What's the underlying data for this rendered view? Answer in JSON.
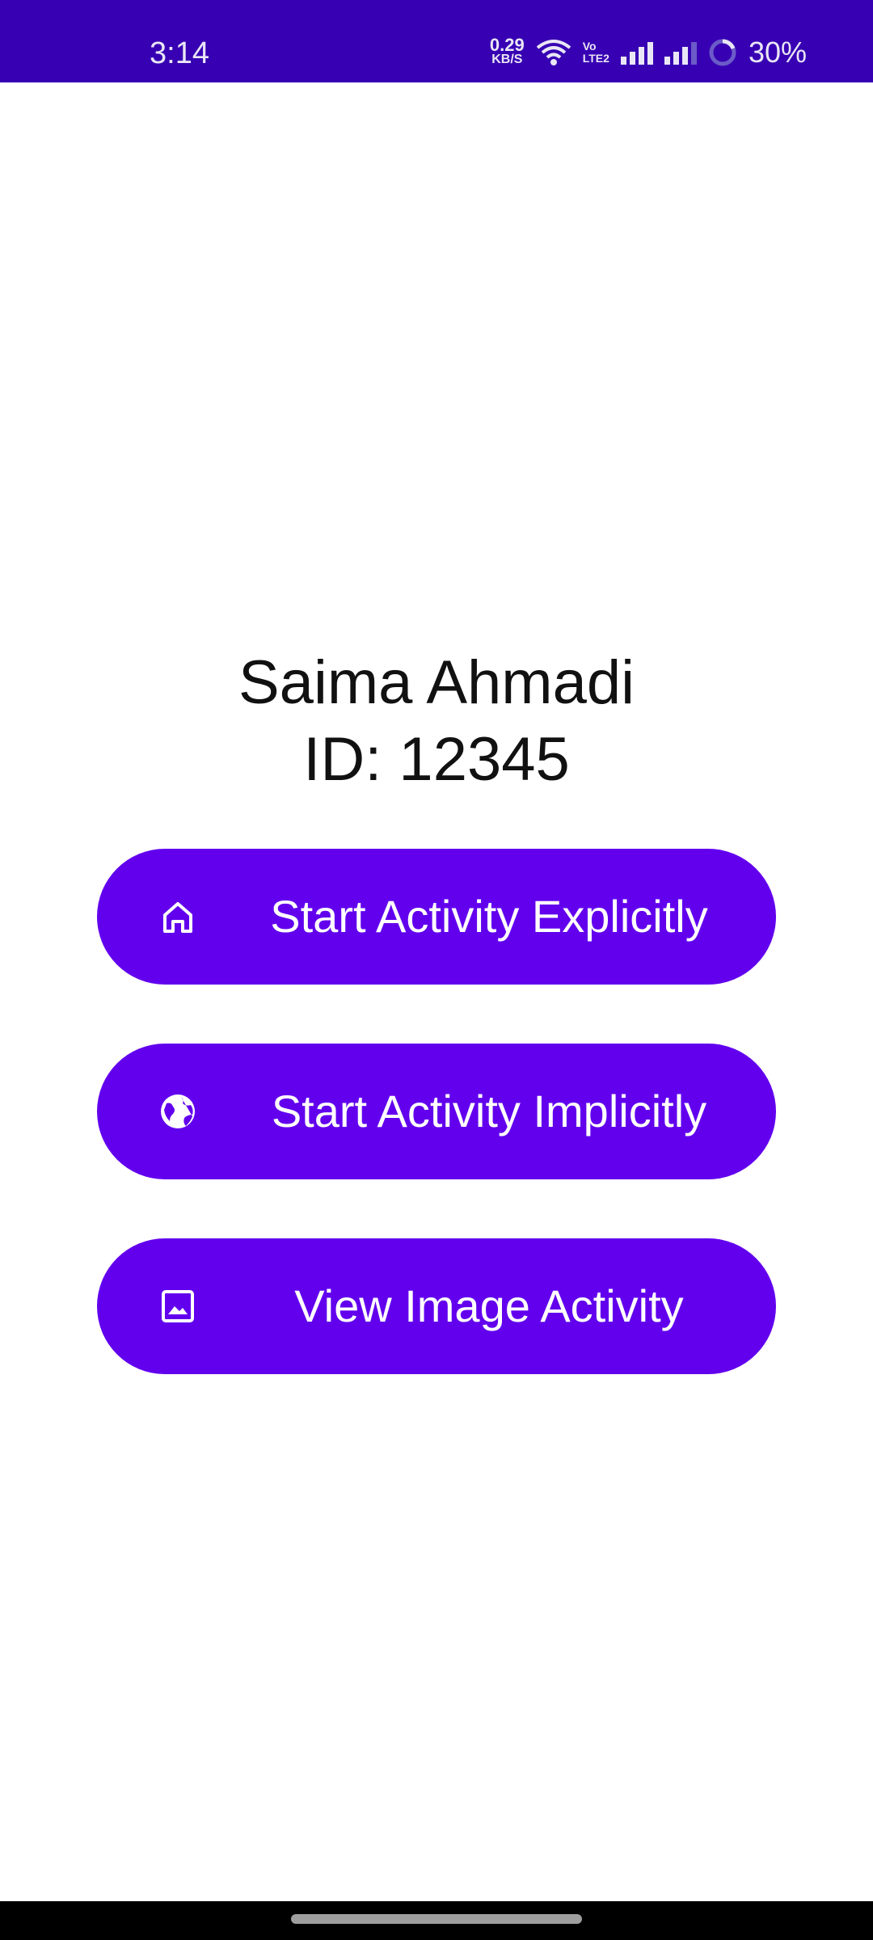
{
  "status_bar": {
    "time": "3:14",
    "net_speed_value": "0.29",
    "net_speed_unit": "KB/S",
    "volte_top": "Vo",
    "volte_bottom": "LTE2",
    "battery": "30%",
    "icons": [
      "wifi-icon",
      "signal-icon",
      "battery-ring-icon"
    ]
  },
  "profile": {
    "name": "Saima Ahmadi",
    "id": "ID: 12345"
  },
  "buttons": [
    {
      "label": "Start Activity Explicitly",
      "icon": "home-icon"
    },
    {
      "label": "Start Activity Implicitly",
      "icon": "globe-icon"
    },
    {
      "label": "View Image Activity",
      "icon": "image-icon"
    }
  ],
  "colors": {
    "status_bar": "#3700B3",
    "button": "#6200EE",
    "button_text": "#FFFFFF",
    "text": "#111111",
    "background": "#FFFFFF",
    "nav_bar": "#000000"
  }
}
